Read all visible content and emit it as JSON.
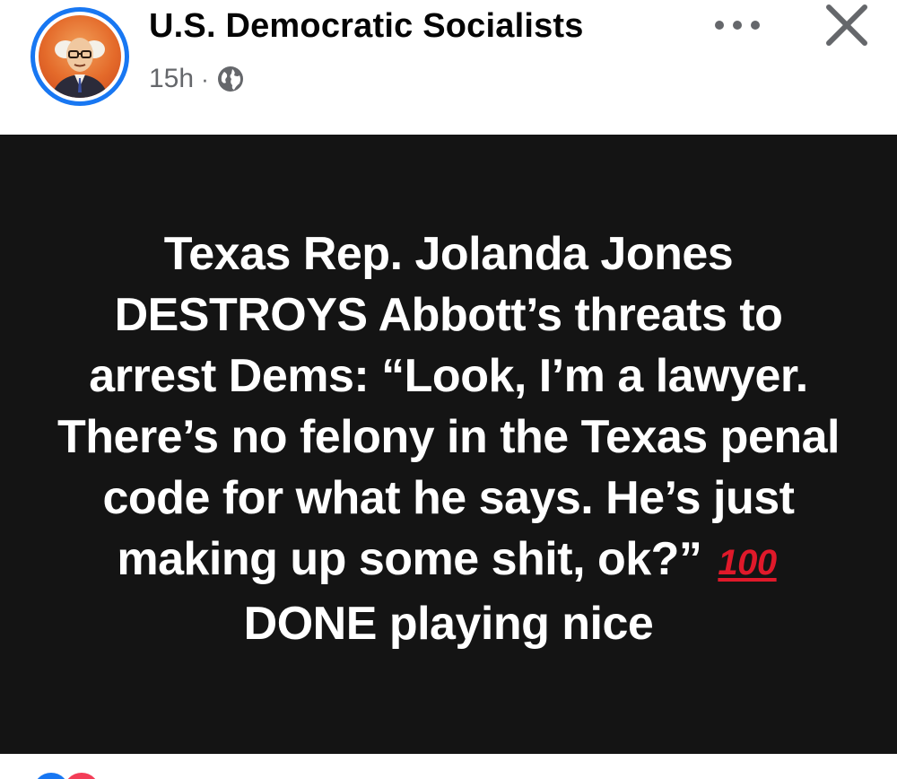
{
  "post": {
    "page_name": "U.S. Democratic Socialists",
    "time_ago": "15h",
    "separator": "·",
    "privacy_icon": "globe-icon",
    "avatar_icon": "profile-portrait-icon",
    "more_icon": "more-options-icon",
    "close_icon": "close-icon"
  },
  "image_text": {
    "before_emoji": "Texas Rep. Jolanda Jones DESTROYS Abbott’s threats to arrest Dems: “Look, I’m a lawyer. There’s no felony in the Texas penal code for what he says. He’s just making up some shit, ok?”",
    "emoji": "100",
    "after_emoji": "DONE playing nice"
  },
  "reactions": {
    "like_icon": "like-reaction-icon",
    "love_icon": "love-reaction-icon"
  },
  "colors": {
    "accent": "#1877f2",
    "image_bg": "#141414",
    "emoji_red": "#e0192a",
    "meta_gray": "#65676b"
  }
}
